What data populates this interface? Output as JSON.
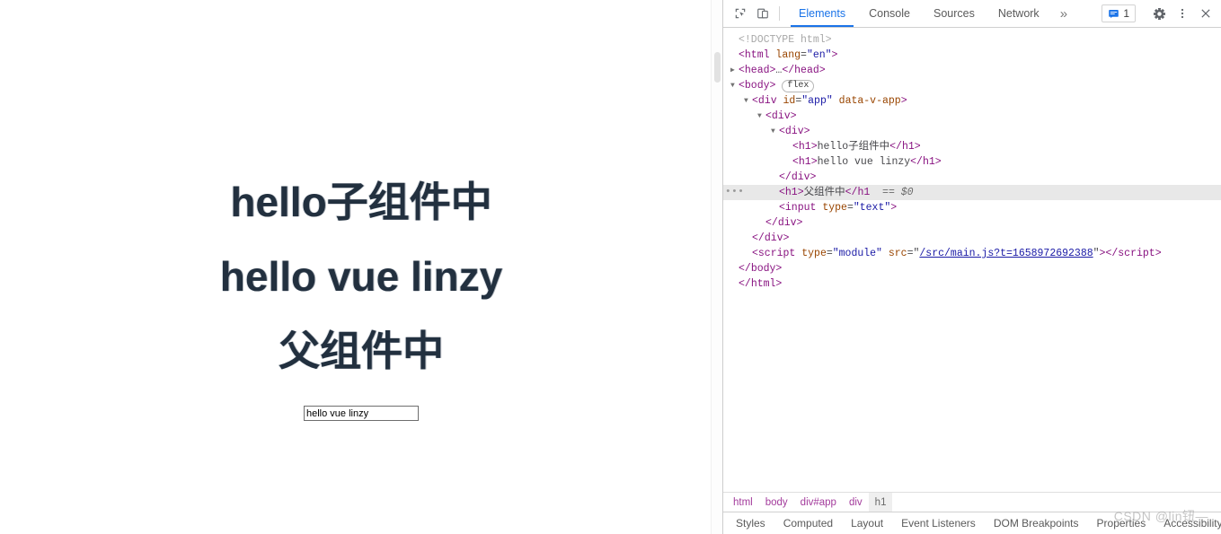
{
  "page": {
    "headings": [
      "hello子组件中",
      "hello vue linzy",
      "父组件中"
    ],
    "input_value": "hello vue linzy",
    "input_placeholder": ""
  },
  "devtools": {
    "toolbar": {
      "inspect_icon": "inspect-element-picker-icon",
      "device_icon": "device-toolbar-icon",
      "tabs": [
        {
          "label": "Elements",
          "active": true
        },
        {
          "label": "Console",
          "active": false
        },
        {
          "label": "Sources",
          "active": false
        },
        {
          "label": "Network",
          "active": false
        }
      ],
      "more_tabs_label": "»",
      "issues_count": "1",
      "issues_icon": "issues-message-icon",
      "settings_icon": "gear-icon",
      "menu_icon": "kebab-menu-icon",
      "close_icon": "close-icon",
      "accent_color": "#1a73e8"
    },
    "dom_tree": [
      {
        "indent": 0,
        "tri": "blank",
        "selected": false,
        "parts": [
          {
            "c": "doctype",
            "t": "<!DOCTYPE html>"
          }
        ]
      },
      {
        "indent": 0,
        "tri": "blank",
        "selected": false,
        "parts": [
          {
            "c": "angle",
            "t": "<"
          },
          {
            "c": "tag",
            "t": "html"
          },
          {
            "c": "txt",
            "t": " "
          },
          {
            "c": "attrn",
            "t": "lang"
          },
          {
            "c": "txt",
            "t": "="
          },
          {
            "c": "attrv",
            "t": "\"en\""
          },
          {
            "c": "angle",
            "t": ">"
          }
        ]
      },
      {
        "indent": 0,
        "tri": "closed",
        "selected": false,
        "parts": [
          {
            "c": "angle",
            "t": "<"
          },
          {
            "c": "tag",
            "t": "head"
          },
          {
            "c": "angle",
            "t": ">"
          },
          {
            "c": "txt",
            "t": "…"
          },
          {
            "c": "angle",
            "t": "</"
          },
          {
            "c": "tag",
            "t": "head"
          },
          {
            "c": "angle",
            "t": ">"
          }
        ]
      },
      {
        "indent": 0,
        "tri": "open",
        "selected": false,
        "parts": [
          {
            "c": "angle",
            "t": "<"
          },
          {
            "c": "tag",
            "t": "body"
          },
          {
            "c": "angle",
            "t": "> "
          },
          {
            "c": "badge",
            "t": "flex"
          }
        ]
      },
      {
        "indent": 1,
        "tri": "open",
        "selected": false,
        "parts": [
          {
            "c": "angle",
            "t": "<"
          },
          {
            "c": "tag",
            "t": "div"
          },
          {
            "c": "txt",
            "t": " "
          },
          {
            "c": "attrn",
            "t": "id"
          },
          {
            "c": "txt",
            "t": "="
          },
          {
            "c": "attrv",
            "t": "\"app\""
          },
          {
            "c": "txt",
            "t": " "
          },
          {
            "c": "attrn",
            "t": "data-v-app"
          },
          {
            "c": "angle",
            "t": ">"
          }
        ]
      },
      {
        "indent": 2,
        "tri": "open",
        "selected": false,
        "parts": [
          {
            "c": "angle",
            "t": "<"
          },
          {
            "c": "tag",
            "t": "div"
          },
          {
            "c": "angle",
            "t": ">"
          }
        ]
      },
      {
        "indent": 3,
        "tri": "open",
        "selected": false,
        "parts": [
          {
            "c": "angle",
            "t": "<"
          },
          {
            "c": "tag",
            "t": "div"
          },
          {
            "c": "angle",
            "t": ">"
          }
        ]
      },
      {
        "indent": 4,
        "tri": "blank",
        "selected": false,
        "parts": [
          {
            "c": "angle",
            "t": "<"
          },
          {
            "c": "tag",
            "t": "h1"
          },
          {
            "c": "angle",
            "t": ">"
          },
          {
            "c": "txt",
            "t": "hello子组件中"
          },
          {
            "c": "angle",
            "t": "</"
          },
          {
            "c": "tag",
            "t": "h1"
          },
          {
            "c": "angle",
            "t": ">"
          }
        ]
      },
      {
        "indent": 4,
        "tri": "blank",
        "selected": false,
        "parts": [
          {
            "c": "angle",
            "t": "<"
          },
          {
            "c": "tag",
            "t": "h1"
          },
          {
            "c": "angle",
            "t": ">"
          },
          {
            "c": "txt",
            "t": "hello vue linzy"
          },
          {
            "c": "angle",
            "t": "</"
          },
          {
            "c": "tag",
            "t": "h1"
          },
          {
            "c": "angle",
            "t": ">"
          }
        ]
      },
      {
        "indent": 3,
        "tri": "blank",
        "selected": false,
        "parts": [
          {
            "c": "angle",
            "t": "</"
          },
          {
            "c": "tag",
            "t": "div"
          },
          {
            "c": "angle",
            "t": ">"
          }
        ]
      },
      {
        "indent": 3,
        "tri": "blank",
        "selected": true,
        "gutter": "•••",
        "parts": [
          {
            "c": "angle",
            "t": "<"
          },
          {
            "c": "tag",
            "t": "h1"
          },
          {
            "c": "angle",
            "t": ">"
          },
          {
            "c": "txt",
            "t": "父组件中"
          },
          {
            "c": "angle",
            "t": "</"
          },
          {
            "c": "tag",
            "t": "h1"
          },
          {
            "c": "eq0",
            "t": "  == $0"
          }
        ]
      },
      {
        "indent": 3,
        "tri": "blank",
        "selected": false,
        "parts": [
          {
            "c": "angle",
            "t": "<"
          },
          {
            "c": "tag",
            "t": "input"
          },
          {
            "c": "txt",
            "t": " "
          },
          {
            "c": "attrn",
            "t": "type"
          },
          {
            "c": "txt",
            "t": "="
          },
          {
            "c": "attrv",
            "t": "\"text\""
          },
          {
            "c": "angle",
            "t": ">"
          }
        ]
      },
      {
        "indent": 2,
        "tri": "blank",
        "selected": false,
        "parts": [
          {
            "c": "angle",
            "t": "</"
          },
          {
            "c": "tag",
            "t": "div"
          },
          {
            "c": "angle",
            "t": ">"
          }
        ]
      },
      {
        "indent": 1,
        "tri": "blank",
        "selected": false,
        "parts": [
          {
            "c": "angle",
            "t": "</"
          },
          {
            "c": "tag",
            "t": "div"
          },
          {
            "c": "angle",
            "t": ">"
          }
        ]
      },
      {
        "indent": 1,
        "tri": "blank",
        "selected": false,
        "parts": [
          {
            "c": "angle",
            "t": "<"
          },
          {
            "c": "tag",
            "t": "script"
          },
          {
            "c": "txt",
            "t": " "
          },
          {
            "c": "attrn",
            "t": "type"
          },
          {
            "c": "txt",
            "t": "="
          },
          {
            "c": "attrv",
            "t": "\"module\""
          },
          {
            "c": "txt",
            "t": " "
          },
          {
            "c": "attrn",
            "t": "src"
          },
          {
            "c": "txt",
            "t": "=\""
          },
          {
            "c": "link",
            "t": "/src/main.js?t=1658972692388"
          },
          {
            "c": "txt",
            "t": "\""
          },
          {
            "c": "angle",
            "t": "></"
          },
          {
            "c": "tag",
            "t": "script"
          },
          {
            "c": "angle",
            "t": ">"
          }
        ]
      },
      {
        "indent": 0,
        "tri": "blank",
        "selected": false,
        "parts": [
          {
            "c": "angle",
            "t": "</"
          },
          {
            "c": "tag",
            "t": "body"
          },
          {
            "c": "angle",
            "t": ">"
          }
        ]
      },
      {
        "indent": -1,
        "tri": "blank",
        "selected": false,
        "parts": [
          {
            "c": "angle",
            "t": "</"
          },
          {
            "c": "tag",
            "t": "html"
          },
          {
            "c": "angle",
            "t": ">"
          }
        ]
      }
    ],
    "breadcrumb": [
      {
        "label": "html",
        "selected": false
      },
      {
        "label": "body",
        "selected": false
      },
      {
        "label": "div#app",
        "selected": false
      },
      {
        "label": "div",
        "selected": false
      },
      {
        "label": "h1",
        "selected": true
      }
    ],
    "bottom_tabs": [
      "Styles",
      "Computed",
      "Layout",
      "Event Listeners",
      "DOM Breakpoints",
      "Properties",
      "Accessibility"
    ]
  },
  "watermark": "CSDN @lin钮—"
}
